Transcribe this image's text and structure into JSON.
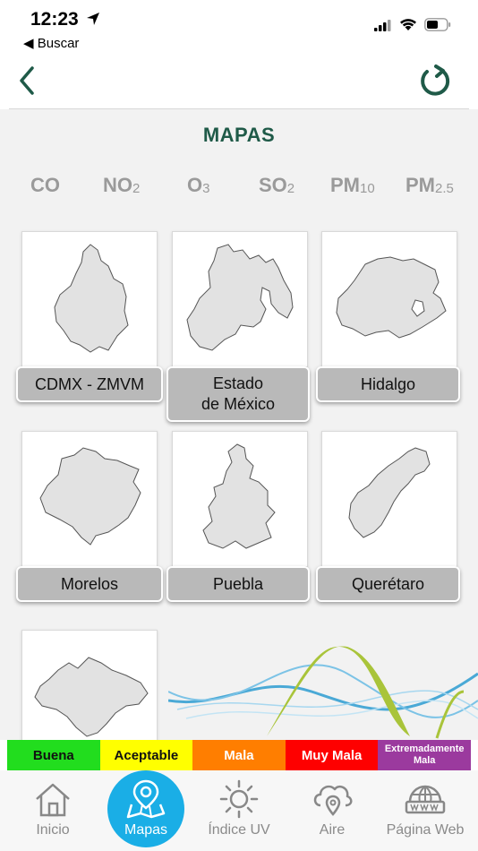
{
  "status_bar": {
    "time": "12:23",
    "back_app": "Buscar"
  },
  "page": {
    "title": "MAPAS"
  },
  "pollutants": [
    {
      "main": "CO",
      "sub": ""
    },
    {
      "main": "NO",
      "sub": "2"
    },
    {
      "main": "O",
      "sub": "3"
    },
    {
      "main": "SO",
      "sub": "2"
    },
    {
      "main": "PM",
      "sub": "10"
    },
    {
      "main": "PM",
      "sub": "2.5"
    }
  ],
  "regions": [
    {
      "label": "CDMX - ZMVM",
      "icon": "cdmx-map-icon"
    },
    {
      "label": "Estado\nde México",
      "icon": "estado-de-mexico-map-icon"
    },
    {
      "label": "Hidalgo",
      "icon": "hidalgo-map-icon"
    },
    {
      "label": "Morelos",
      "icon": "morelos-map-icon"
    },
    {
      "label": "Puebla",
      "icon": "puebla-map-icon"
    },
    {
      "label": "Querétaro",
      "icon": "queretaro-map-icon"
    },
    {
      "label": "",
      "icon": "tlaxcala-map-icon"
    }
  ],
  "legend": [
    {
      "label": "Buena",
      "color": "#22dd1e"
    },
    {
      "label": "Aceptable",
      "color": "#ffff00"
    },
    {
      "label": "Mala",
      "color": "#ff7e00"
    },
    {
      "label": "Muy Mala",
      "color": "#fe0000"
    },
    {
      "label": "Extremadamente Mala",
      "color": "#9b3a9e"
    }
  ],
  "tabs": [
    {
      "label": "Inicio",
      "icon": "home-icon",
      "active": false
    },
    {
      "label": "Mapas",
      "icon": "map-pin-icon",
      "active": true
    },
    {
      "label": "Índice UV",
      "icon": "sun-icon",
      "active": false
    },
    {
      "label": "Aire",
      "icon": "cloud-location-icon",
      "active": false
    },
    {
      "label": "Página Web",
      "icon": "globe-web-icon",
      "active": false
    }
  ],
  "colors": {
    "accent_green": "#1f5a48",
    "tab_active": "#1aaee6"
  }
}
